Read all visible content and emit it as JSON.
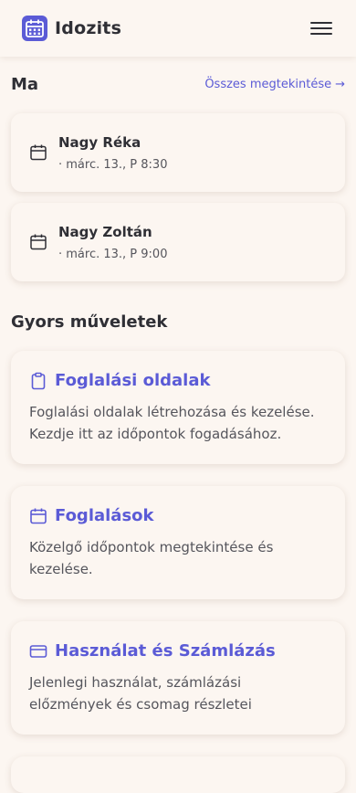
{
  "header": {
    "app_title": "Idozits",
    "logo_icon": "calendar-icon",
    "menu_icon": "hamburger-icon"
  },
  "today": {
    "title": "Ma",
    "see_all_label": "Összes megtekintése",
    "see_all_arrow": "→",
    "appointments": [
      {
        "name": "Nagy Réka",
        "when": "· márc. 13., P 8:30",
        "icon": "calendar-icon"
      },
      {
        "name": "Nagy Zoltán",
        "when": "· márc. 13., P 9:00",
        "icon": "calendar-icon"
      }
    ]
  },
  "quick_actions": {
    "title": "Gyors műveletek",
    "items": [
      {
        "title": "Foglalási oldalak",
        "desc": "Foglalási oldalak létrehozása és kezelése. Kezdje itt az időpontok fogadásához.",
        "icon": "clipboard-icon"
      },
      {
        "title": "Foglalások",
        "desc": "Közelgő időpontok megtekintése és kezelése.",
        "icon": "calendar-icon"
      },
      {
        "title": "Használat és Számlázás",
        "desc": "Jelenlegi használat, számlázási előzmények és csomag részletei",
        "icon": "credit-card-icon"
      }
    ]
  },
  "colors": {
    "accent": "#5b5bd6",
    "background": "#fcf6f1",
    "text": "#2f2f35",
    "muted": "#55555c"
  }
}
